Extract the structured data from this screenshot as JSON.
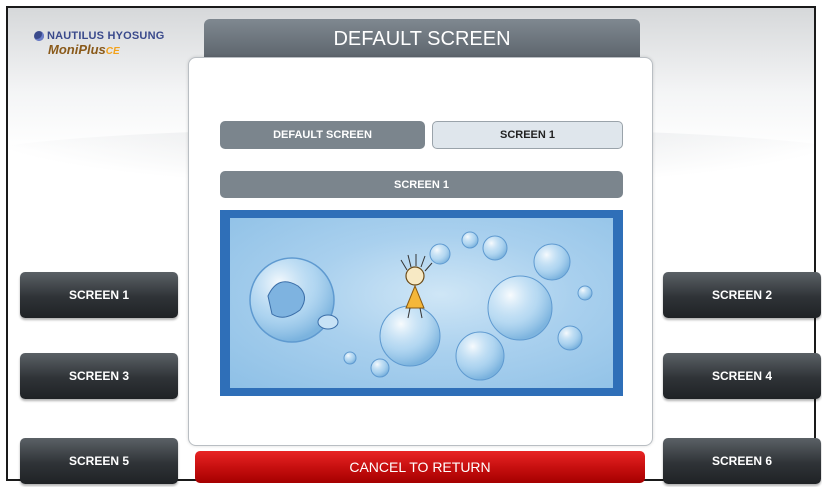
{
  "logo": {
    "brand": "NAUTILUS HYOSUNG",
    "product": "MoniPlus",
    "product_suffix": "CE"
  },
  "header": {
    "title": "DEFAULT SCREEN"
  },
  "tabs": [
    {
      "label": "DEFAULT SCREEN",
      "selected": false
    },
    {
      "label": "SCREEN 1",
      "selected": true
    }
  ],
  "preview": {
    "title": "SCREEN 1"
  },
  "left_buttons": [
    {
      "label": "SCREEN 1"
    },
    {
      "label": "SCREEN 3"
    },
    {
      "label": "SCREEN 5"
    }
  ],
  "right_buttons": [
    {
      "label": "SCREEN 2"
    },
    {
      "label": "SCREEN 4"
    },
    {
      "label": "SCREEN 6"
    }
  ],
  "footer": {
    "cancel_label": "CANCEL TO RETURN"
  },
  "colors": {
    "header_bg": "#6e777f",
    "tab_active": "#dfe6ec",
    "tab_inactive": "#7b858d",
    "side_button": "#2f3337",
    "cancel_button": "#d01010",
    "preview_border": "#2f6fb8"
  }
}
